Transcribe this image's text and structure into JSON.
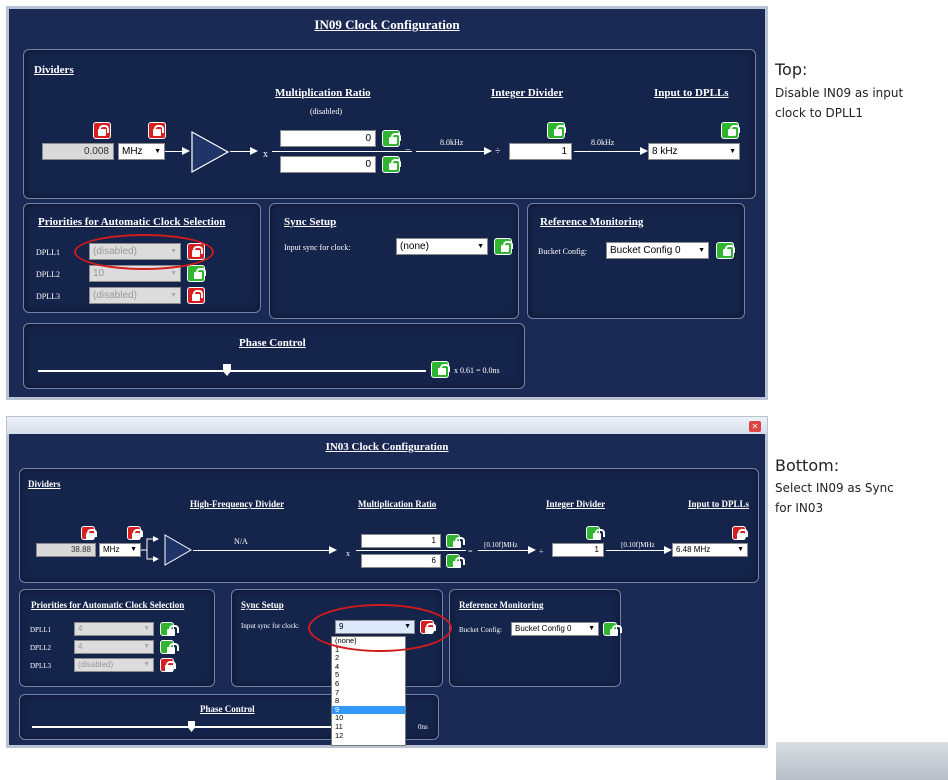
{
  "top": {
    "title": "IN09 Clock Configuration",
    "dividers": {
      "heading": "Dividers",
      "mult_ratio_label": "Multiplication Ratio",
      "mult_status": "(disabled)",
      "int_div_label": "Integer Divider",
      "input_dplls_label": "Input to DPLLs",
      "freq_value": "0.008",
      "unit": "MHz",
      "x_sign": "x",
      "num": "0",
      "den": "0",
      "eq": "=",
      "freq1": "8.0kHz",
      "div_sign": "÷",
      "int_div": "1",
      "freq2": "8.0kHz",
      "dpll_input": "8 kHz"
    },
    "priorities": {
      "heading": "Priorities for Automatic Clock Selection",
      "rows": [
        {
          "label": "DPLL1",
          "value": "(disabled)"
        },
        {
          "label": "DPLL2",
          "value": "10"
        },
        {
          "label": "DPLL3",
          "value": "(disabled)"
        }
      ]
    },
    "sync": {
      "heading": "Sync Setup",
      "label": "Input sync for clock:",
      "value": "(none)"
    },
    "refmon": {
      "heading": "Reference Monitoring",
      "label": "Bucket Config:",
      "value": "Bucket Config 0"
    },
    "phase": {
      "heading": "Phase Control",
      "readout": "x 0.61 = 0.0ns"
    }
  },
  "bottom": {
    "title": "IN03 Clock Configuration",
    "dividers": {
      "heading": "Dividers",
      "hf_div_label": "High-Frequency Divider",
      "mult_ratio_label": "Multiplication Ratio",
      "int_div_label": "Integer Divider",
      "input_dplls_label": "Input to DPLLs",
      "freq_value": "38.88",
      "unit": "MHz",
      "hf_status": "N/A",
      "x_sign": "x",
      "num": "1",
      "den": "6",
      "eq": "=",
      "freq1": "[0.10f]MHz",
      "div_sign": "÷",
      "int_div": "1",
      "freq2": "[0.10f]MHz",
      "dpll_input": "6.48 MHz"
    },
    "priorities": {
      "heading": "Priorities for Automatic Clock Selection",
      "rows": [
        {
          "label": "DPLL1",
          "value": "4"
        },
        {
          "label": "DPLL2",
          "value": "4"
        },
        {
          "label": "DPLL3",
          "value": "(disabled)"
        }
      ]
    },
    "sync": {
      "heading": "Sync Setup",
      "label": "Input sync for clock:",
      "value": "9",
      "options": [
        "(none)",
        "1",
        "2",
        "4",
        "5",
        "6",
        "7",
        "8",
        "9",
        "10",
        "11",
        "12"
      ],
      "selected": "9"
    },
    "refmon": {
      "heading": "Reference Monitoring",
      "label": "Bucket Config:",
      "value": "Bucket Config 0"
    },
    "phase": {
      "heading": "Phase Control",
      "readout_tail": "0ns"
    }
  },
  "notes": {
    "top_heading": "Top:",
    "top_text_1": "Disable IN09 as input",
    "top_text_2": "clock to DPLL1",
    "bottom_heading": "Bottom:",
    "bottom_text_1": "Select IN09 as Sync",
    "bottom_text_2": "for IN03"
  },
  "colors": {
    "panel_bg": "#15244b",
    "window_bg": "#1a2a55",
    "lock_red": "#d42020",
    "lock_green": "#2fb52f",
    "highlight": "#d11c1c",
    "select_blue": "#3399ff"
  }
}
